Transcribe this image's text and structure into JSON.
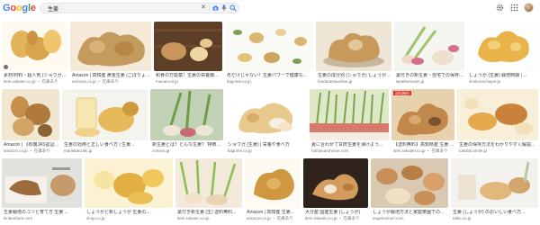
{
  "header": {
    "logo_letters": [
      {
        "ch": "G",
        "color": "#4285f4"
      },
      {
        "ch": "o",
        "color": "#ea4335"
      },
      {
        "ch": "o",
        "color": "#fbbc05"
      },
      {
        "ch": "g",
        "color": "#4285f4"
      },
      {
        "ch": "l",
        "color": "#34a853"
      },
      {
        "ch": "e",
        "color": "#ea4335"
      }
    ],
    "search_query": "生姜",
    "clear_glyph": "✕",
    "icons": [
      "close-icon",
      "camera-icon",
      "mic-icon",
      "search-icon",
      "gear-icon",
      "apps-icon",
      "avatar"
    ]
  },
  "rows": [
    {
      "cards": [
        {
          "caption": "素材/材料・超人気 (ショウガ) けい...",
          "source": "item.rakuten.co.jp ・ 在庫あり",
          "palette": [
            "#f3e3b8",
            "#d9a44e",
            "#fff"
          ]
        },
        {
          "caption": "Amazon | 高知産 黄金生姜 (ごぼりょう...",
          "source": "amazon.co.jp ・ 在庫あり",
          "palette": [
            "#c9a26a",
            "#b68748",
            "#e8d3ae"
          ]
        },
        {
          "caption": "和食の万能薬！生姜の栄養価を分析...",
          "source": "macaro-ni.jp",
          "palette": [
            "#6e4a2c",
            "#e9c88f",
            "#b88c57"
          ]
        },
        {
          "caption": "冬だけじゃない！生姜パワーで健康な...",
          "source": "kagome.co.jp",
          "palette": [
            "#f7f7f2",
            "#d9b770",
            "#7ba04a"
          ]
        },
        {
          "caption": "生姜の成分別 (ショウガ) しょうが...",
          "source": "foodoramaonline.jp",
          "palette": [
            "#efe6d6",
            "#c79a5c",
            "#e2c898"
          ]
        },
        {
          "caption": "葉付きの新生姜・自宅での保存方法...",
          "source": "weathernews.jp",
          "palette": [
            "#f4f4f1",
            "#d6708a",
            "#9fc36a"
          ]
        },
        {
          "caption": "しょうが (生姜) 栽培時期 | ...",
          "source": "shokuzai-bayer.jp",
          "palette": [
            "#fdfdfb",
            "#e8b44a",
            "#f3d27c"
          ]
        }
      ]
    },
    {
      "cards": [
        {
          "caption": "Amazon | 【有機JAS認証】生姜...",
          "source": "amazon.co.jp ・ 在庫あり",
          "palette": [
            "#e1c68e",
            "#c78f4c",
            "#8a6233"
          ]
        },
        {
          "caption": "生姜の効用と正しい食べ方 | 生姜...",
          "source": "mariekanzaki.jp",
          "palette": [
            "#f5f3ee",
            "#e7b95a",
            "#cf9a3b"
          ]
        },
        {
          "caption": "新生姜とは？どんな生姜？ 特徴と...",
          "source": "oceans.jp",
          "palette": [
            "#c1d2b6",
            "#c86a73",
            "#ede6d4"
          ]
        },
        {
          "caption": "ショウガ (生姜) | 栄養や食べ方",
          "source": "kagome.co.jp",
          "palette": [
            "#f6f0e4",
            "#e8c98e",
            "#d6ad6a"
          ]
        },
        {
          "caption": "夏に合わせて甘酢生姜を漬けよう...",
          "source": "hanamaruhome.com",
          "palette": [
            "#dfe9c9",
            "#d77a6c",
            "#7aa54e"
          ]
        },
        {
          "caption": "【送料無料】高知県産 生姜 (しょうが)...",
          "source": "item.rakuten.co.jp ・ 在庫あり",
          "palette": [
            "#e7d2ad",
            "#c2874a",
            "#7a5333"
          ]
        },
        {
          "caption": "生姜の保存方法をわかりやすく解説...",
          "source": "tokubai.smile.jp",
          "palette": [
            "#f3dfba",
            "#e4a94b",
            "#c9823b"
          ]
        }
      ]
    },
    {
      "cards": [
        {
          "caption": "生姜栽培のコツと育て方 生姜 ...",
          "source": "kinbenfarm.com",
          "palette": [
            "#e2e2dc",
            "#9c6b3d",
            "#f5f1ea"
          ]
        },
        {
          "caption": "しょうがと新しょうが 生姜の...",
          "source": "shop.co.jp",
          "palette": [
            "#f7e3a2",
            "#e2b042",
            "#fbf2d3"
          ]
        },
        {
          "caption": "葉付き新生姜 (生) 送料無料...",
          "source": "item.rakuten.co.jp",
          "palette": [
            "#d9e4cf",
            "#8ac052",
            "#f3eadb"
          ]
        },
        {
          "caption": "Amazon | 高知産 生姜...",
          "source": "amazon.co.jp ・ 在庫あり",
          "palette": [
            "#efe5cf",
            "#cf973f",
            "#fdfaf3"
          ]
        },
        {
          "caption": "大分産 国産生姜 (しょうが)",
          "source": "item.rakuten.co.jp ・ 在庫あり",
          "palette": [
            "#3a2a22",
            "#d39b5e",
            "#f4e7d2"
          ]
        },
        {
          "caption": "しょうが栽培方法と家庭菜園での...",
          "source": "engeinomori.com",
          "palette": [
            "#d9c9b3",
            "#c98f58",
            "#f1e0c4"
          ]
        },
        {
          "caption": "生姜 (しょうが) のおいしい食べ方...",
          "source": "taiko.co.jp",
          "palette": [
            "#f4f2ef",
            "#e1b77c",
            "#b9c8a3"
          ]
        }
      ]
    }
  ]
}
